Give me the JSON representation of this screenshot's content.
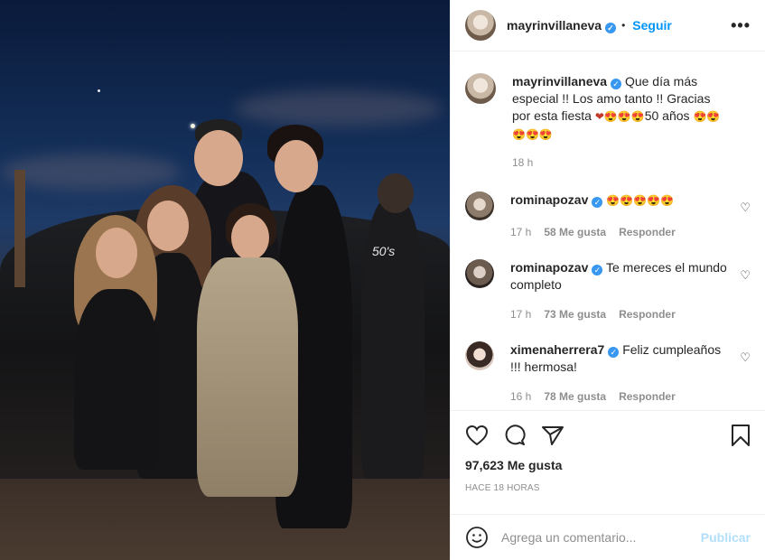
{
  "post": {
    "username": "mayrinvillaneva",
    "follow_label": "Seguir",
    "separator": "•",
    "more_label": "•••",
    "caption_part1": "Que día más especial !! Los amo tanto !! Gracias por esta fiesta ",
    "caption_emojis1": "❤😍😍😍",
    "caption_part2": "50 años ",
    "caption_emojis2": "😍😍😍😍😍",
    "caption_time": "18 h",
    "likes": "97,623 Me gusta",
    "posted": "HACE 18 HORAS"
  },
  "comments": [
    {
      "user": "rominapozav",
      "text": "😍😍😍😍😍",
      "time": "17 h",
      "likes": "58 Me gusta",
      "reply": "Responder"
    },
    {
      "user": "rominapozav",
      "text": "Te mereces el mundo completo",
      "time": "17 h",
      "likes": "73 Me gusta",
      "reply": "Responder"
    },
    {
      "user": "ximenaherrera7",
      "text": "Feliz cumpleaños !!! hermosa!",
      "time": "16 h",
      "likes": "78 Me gusta",
      "reply": "Responder"
    }
  ],
  "composer": {
    "placeholder": "Agrega un comentario...",
    "publish_label": "Publicar"
  },
  "icons": {
    "verified": "✓",
    "heart": "♡",
    "emoji": "☺"
  },
  "photo": {
    "hoodie_text": "50's"
  },
  "colors": {
    "accent": "#0095f6",
    "verified": "#3897f0",
    "publish_disabled": "#b2dffc"
  }
}
